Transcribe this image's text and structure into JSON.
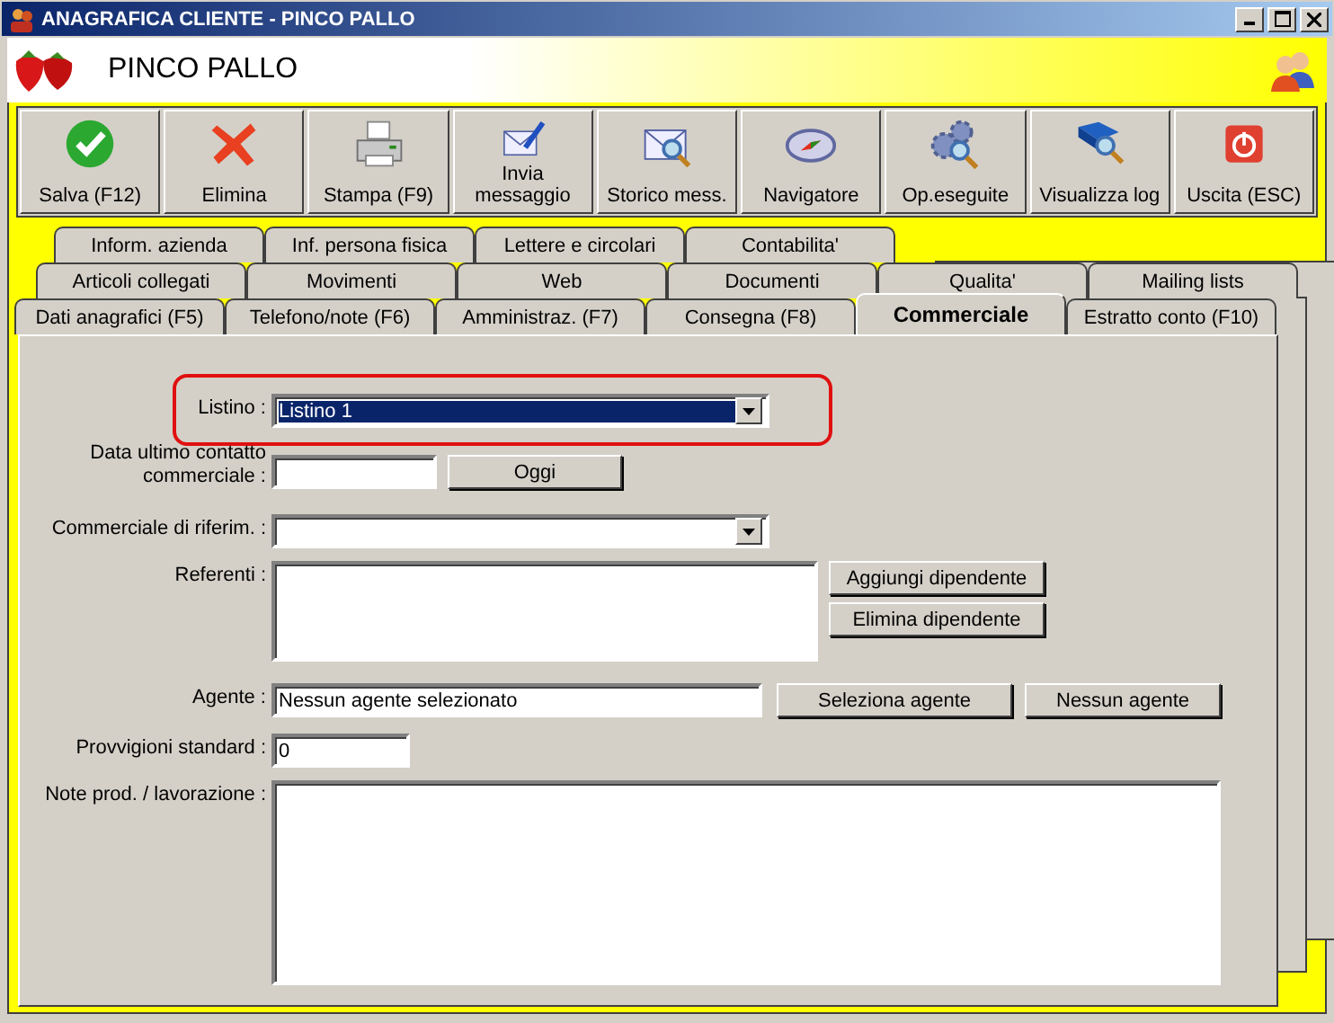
{
  "window": {
    "title": "ANAGRAFICA CLIENTE - PINCO PALLO"
  },
  "header": {
    "name": "PINCO PALLO"
  },
  "toolbar": [
    {
      "label": "Salva (F12)"
    },
    {
      "label": "Elimina"
    },
    {
      "label": "Stampa (F9)"
    },
    {
      "label": "Invia\nmessaggio"
    },
    {
      "label": "Storico mess."
    },
    {
      "label": "Navigatore"
    },
    {
      "label": "Op.eseguite"
    },
    {
      "label": "Visualizza log"
    },
    {
      "label": "Uscita (ESC)"
    }
  ],
  "tab_rows": [
    [
      {
        "label": "Inform. azienda",
        "selected": false
      },
      {
        "label": "Inf. persona fisica",
        "selected": false
      },
      {
        "label": "Lettere e circolari",
        "selected": false
      },
      {
        "label": "Contabilita'",
        "selected": false
      }
    ],
    [
      {
        "label": "Articoli collegati",
        "selected": false
      },
      {
        "label": "Movimenti",
        "selected": false
      },
      {
        "label": "Web",
        "selected": false
      },
      {
        "label": "Documenti",
        "selected": false
      },
      {
        "label": "Qualita'",
        "selected": false
      },
      {
        "label": "Mailing lists",
        "selected": false
      }
    ],
    [
      {
        "label": "Dati anagrafici (F5)",
        "selected": false
      },
      {
        "label": "Telefono/note (F6)",
        "selected": false
      },
      {
        "label": "Amministraz. (F7)",
        "selected": false
      },
      {
        "label": "Consegna (F8)",
        "selected": false
      },
      {
        "label": "Commerciale",
        "selected": true
      },
      {
        "label": "Estratto conto (F10)",
        "selected": false
      }
    ]
  ],
  "form": [
    {
      "kind": "combo",
      "label": "Listino :",
      "value": "Listino 1",
      "focused": true,
      "highlighted": true
    },
    {
      "kind": "text",
      "label": "Data ultimo contatto\ncommerciale :",
      "buttons": [
        "Oggi"
      ]
    },
    {
      "kind": "combo",
      "label": "Commerciale di riferim. :"
    },
    {
      "kind": "list",
      "label": "Referenti :",
      "buttons": [
        "Aggiungi dipendente",
        "Elimina dipendente"
      ]
    },
    {
      "kind": "text",
      "label": "Agente :",
      "value": "Nessun agente selezionato",
      "buttons": [
        "Seleziona agente",
        "Nessun agente"
      ]
    },
    {
      "kind": "text",
      "label": "Provvigioni standard :",
      "value": "0"
    },
    {
      "kind": "memo",
      "label": "Note prod. / lavorazione :"
    }
  ]
}
